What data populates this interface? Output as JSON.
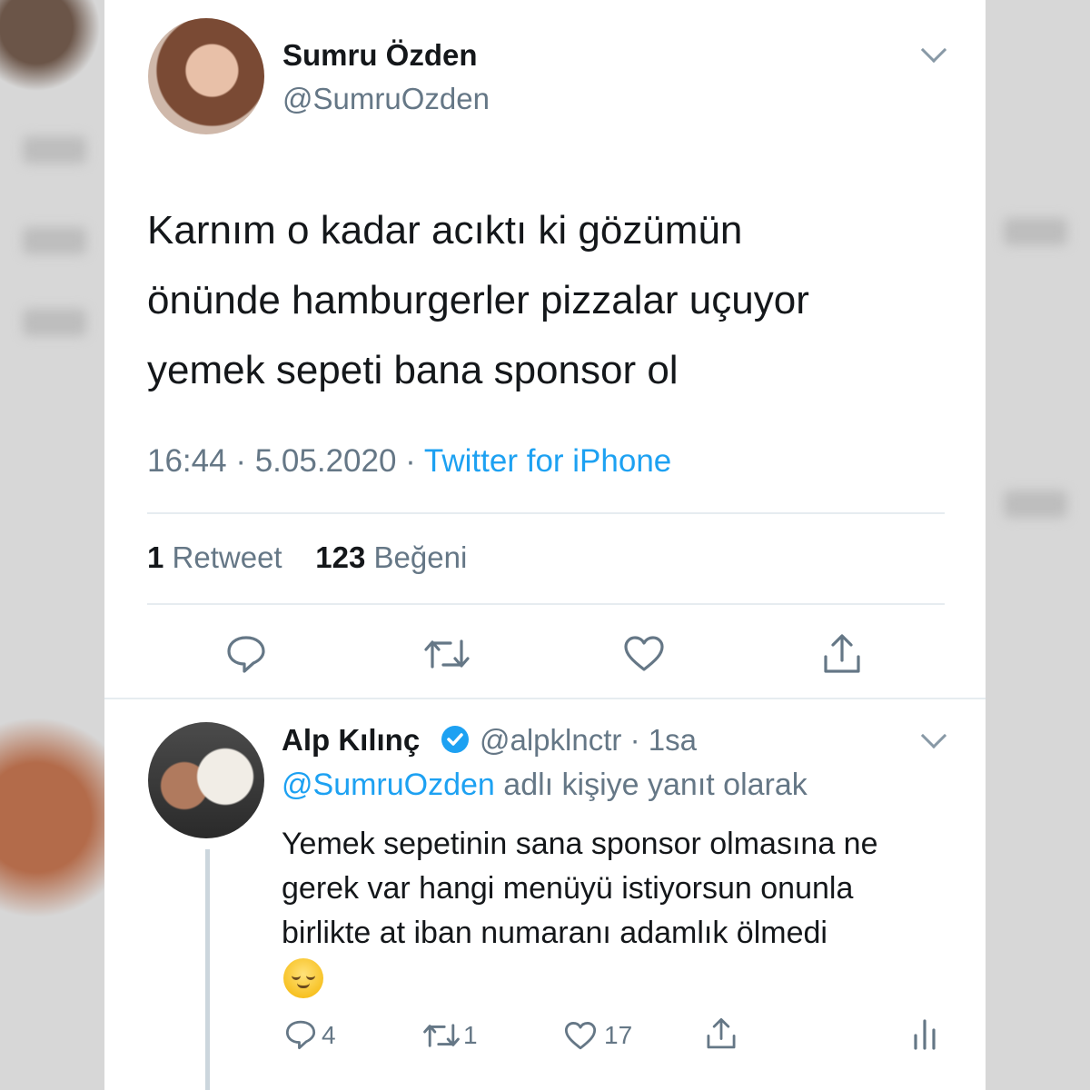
{
  "tweet": {
    "author_name": "Sumru Özden",
    "author_handle": "@SumruOzden",
    "text_line1": "Karnım o kadar acıktı ki gözümün",
    "text_line2": "önünde hamburgerler pizzalar uçuyor",
    "text_line3": "yemek sepeti bana sponsor ol",
    "time": "16:44",
    "date": "5.05.2020",
    "source": "Twitter for iPhone",
    "retweet_count": "1",
    "retweet_label": "Retweet",
    "like_count": "123",
    "like_label": "Beğeni"
  },
  "reply": {
    "author_name": "Alp Kılınç",
    "author_handle": "@alpklnctr",
    "time_ago": "1sa",
    "replying_mention": "@SumruOzden",
    "replying_suffix": "adlı kişiye yanıt olarak",
    "text_line1": "Yemek sepetinin sana sponsor olmasına ne",
    "text_line2": "gerek var hangi menüyü istiyorsun onunla",
    "text_line3": "birlikte at iban numaranı adamlık ölmedi",
    "emoji": "relieved-face-emoji",
    "reply_count": "4",
    "retweet_count": "1",
    "like_count": "17"
  },
  "colors": {
    "text": "#14171a",
    "secondary": "#657786",
    "accent": "#1da1f2",
    "divider": "#e6ecf0"
  },
  "icons": [
    "chevron-down-icon",
    "reply-icon",
    "retweet-icon",
    "like-icon",
    "share-icon",
    "verified-badge-icon",
    "analytics-icon"
  ]
}
